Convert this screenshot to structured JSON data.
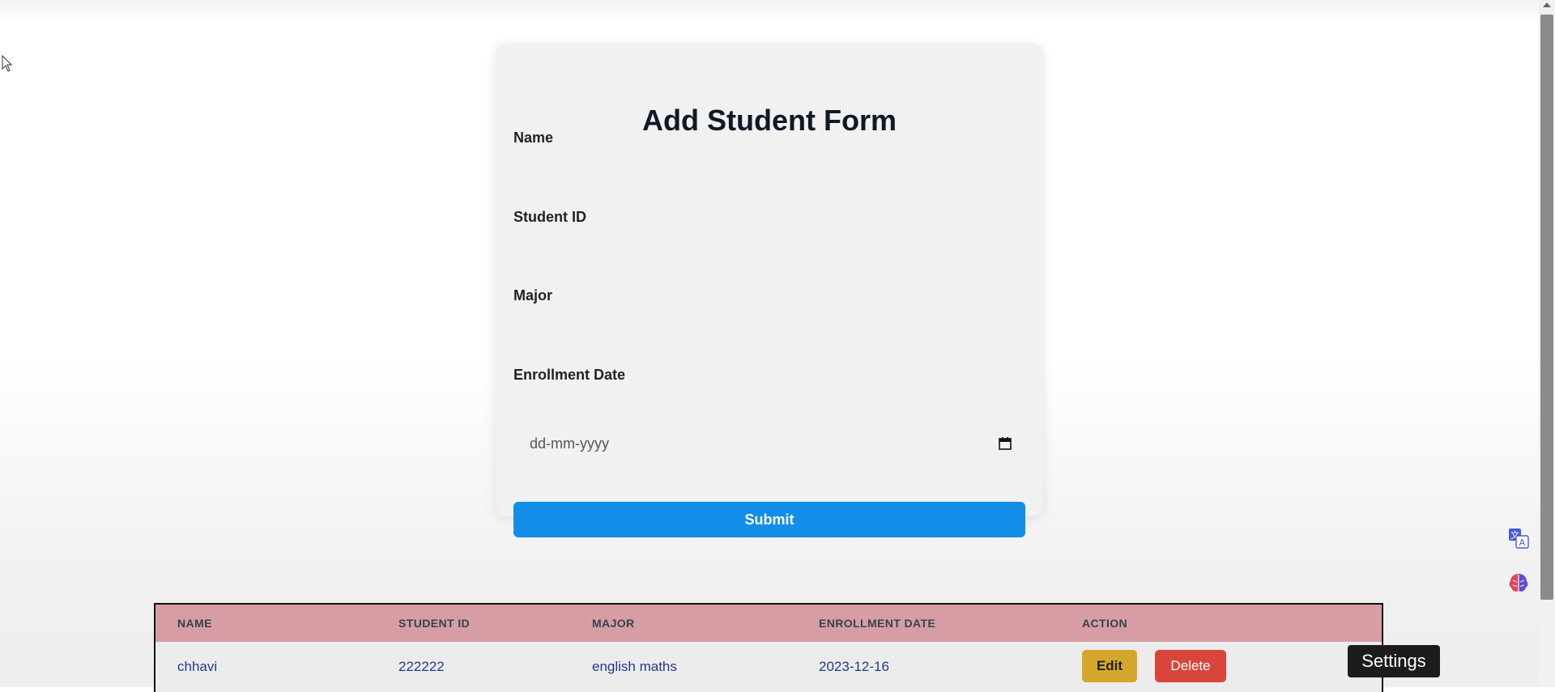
{
  "form": {
    "title": "Add Student Form",
    "name_label": "Name",
    "student_id_label": "Student ID",
    "major_label": "Major",
    "enrollment_date_label": "Enrollment Date",
    "date_placeholder": "dd-mm-yyyy",
    "submit_label": "Submit"
  },
  "table": {
    "headers": [
      "NAME",
      "STUDENT ID",
      "MAJOR",
      "ENROLLMENT DATE",
      "ACTION"
    ],
    "rows": [
      {
        "name": "chhavi",
        "student_id": "222222",
        "major": "english maths",
        "enrollment_date": "2023-12-16",
        "edit_label": "Edit",
        "delete_label": "Delete"
      }
    ],
    "header_color": "#d69ea4"
  },
  "tooltip": {
    "text": "Settings"
  },
  "colors": {
    "submit": "#128ee8",
    "edit": "#d4a72c",
    "delete": "#d9453b"
  },
  "icons": [
    "calendar-icon",
    "translate-icon",
    "brain-icon",
    "cursor-icon"
  ]
}
